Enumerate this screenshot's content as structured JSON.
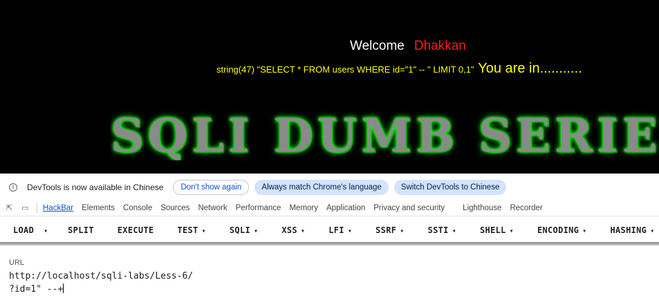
{
  "page": {
    "welcome": "Welcome",
    "username": "Dhakkan",
    "query_debug": "string(47) \"SELECT * FROM users WHERE id=\"1\" -- \" LIMIT 0,1\"",
    "status": "You are in...........",
    "banner": "SQLI DUMB SERIES"
  },
  "infobar": {
    "icon": "info-icon",
    "message": "DevTools is now available in Chinese",
    "dismiss_label": "Don't show again",
    "match_label": "Always match Chrome's language",
    "switch_label": "Switch DevTools to Chinese"
  },
  "devtools": {
    "tabs": [
      "HackBar",
      "Elements",
      "Console",
      "Sources",
      "Network",
      "Performance",
      "Memory",
      "Application",
      "Privacy and security",
      "Lighthouse",
      "Recorder"
    ],
    "active_tab": "HackBar"
  },
  "hackbar": {
    "buttons": [
      "LOAD",
      "SPLIT",
      "EXECUTE",
      "TEST",
      "SQLI",
      "XSS",
      "LFI",
      "SSRF",
      "SSTI",
      "SHELL",
      "ENCODING",
      "HASHING"
    ],
    "url_label": "URL",
    "url_line1": "http://localhost/sqli-labs/Less-6/",
    "url_line2": "?id=1\" --+"
  },
  "colors": {
    "background": "#000000",
    "username": "#ff1a1a",
    "query_text": "#ffff00",
    "banner_glow": "#00ff00",
    "active_tab": "#0b57d0"
  }
}
